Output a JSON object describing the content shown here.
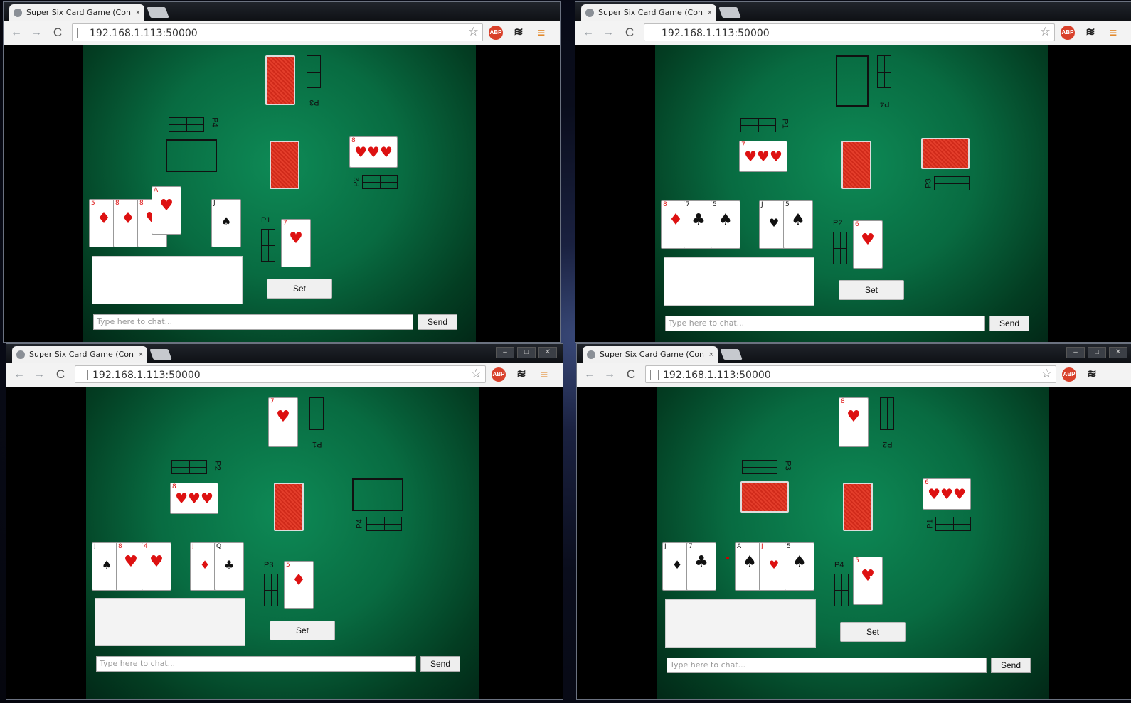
{
  "browser": {
    "tab_title": "Super Six Card Game (Con",
    "tab_close": "×",
    "url": "192.168.1.113:50000",
    "star": "☆",
    "abp": "ABP",
    "layers": "≋",
    "menu": "≡",
    "back": "←",
    "forward": "→",
    "reload": "C",
    "win_min": "–",
    "win_max": "□",
    "win_close": "✕"
  },
  "game": {
    "chat_placeholder": "Type here to chat...",
    "send_label": "Send",
    "set_label": "Set"
  },
  "windows": [
    {
      "player_label": "P1",
      "top_label": "P3",
      "left_label": "P4",
      "right_label": "P2"
    },
    {
      "player_label": "P2",
      "top_label": "P4",
      "left_label": "P1",
      "right_label": "P3"
    },
    {
      "player_label": "P3",
      "top_label": "P1",
      "left_label": "P2",
      "right_label": "P4"
    },
    {
      "player_label": "P4",
      "top_label": "P2",
      "left_label": "P3",
      "right_label": "P1"
    }
  ],
  "colors": {
    "felt": "#086b41",
    "card_back": "#e43e2b",
    "abp": "#d9412b",
    "menu": "#e07b12"
  }
}
